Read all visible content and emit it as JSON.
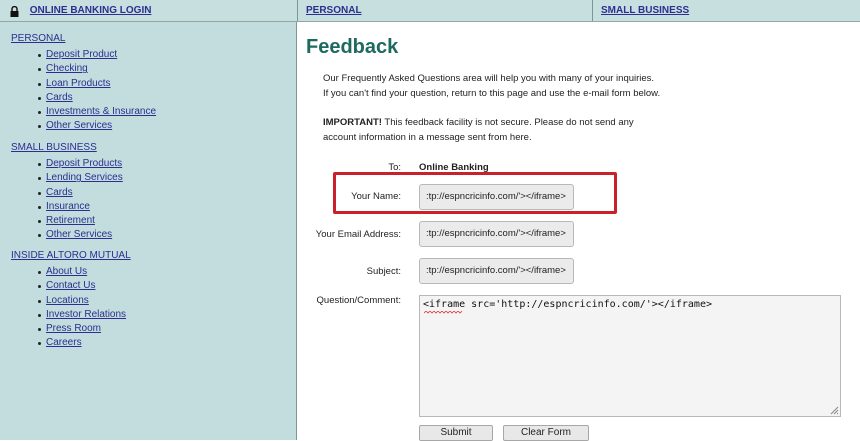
{
  "topnav": {
    "login": "ONLINE BANKING LOGIN",
    "personal": "PERSONAL",
    "small_business": "SMALL BUSINESS"
  },
  "sidebar": {
    "personal": {
      "heading": "PERSONAL",
      "items": [
        "Deposit Product",
        "Checking",
        "Loan Products",
        "Cards",
        "Investments & Insurance",
        "Other Services"
      ]
    },
    "small_business": {
      "heading": "SMALL BUSINESS",
      "items": [
        "Deposit Products",
        "Lending Services",
        "Cards",
        "Insurance",
        "Retirement",
        "Other Services"
      ]
    },
    "inside": {
      "heading": "INSIDE ALTORO MUTUAL",
      "items": [
        "About Us",
        "Contact Us",
        "Locations",
        "Investor Relations",
        "Press Room",
        "Careers"
      ]
    }
  },
  "main": {
    "title": "Feedback",
    "intro_line1": "Our Frequently Asked Questions area will help you with many of your inquiries.",
    "intro_line2": "If you can't find your question, return to this page and use the e-mail form below.",
    "important_label": "IMPORTANT!",
    "important_text": " This feedback facility is not secure. Please do not send any",
    "important_line2": "account information in a message sent from here.",
    "to_label": "To:",
    "to_value": "Online Banking",
    "name_label": "Your Name:",
    "name_value": ":tp://espncricinfo.com/'></iframe>",
    "email_label": "Your Email Address:",
    "email_value": ":tp://espncricinfo.com/'></iframe>",
    "subject_label": "Subject:",
    "subject_value": ":tp://espncricinfo.com/'></iframe>",
    "comment_label": "Question/Comment:",
    "comment_value": "<iframe src='http://espncricinfo.com/'></iframe>",
    "submit_label": "Submit",
    "clear_label": "Clear Form"
  },
  "colors": {
    "sidebar_bg": "#c3dcde",
    "title": "#1c6b5e",
    "highlight": "#c9202a",
    "link": "#2b2f8f"
  },
  "icons": {
    "login": "lock-icon"
  }
}
